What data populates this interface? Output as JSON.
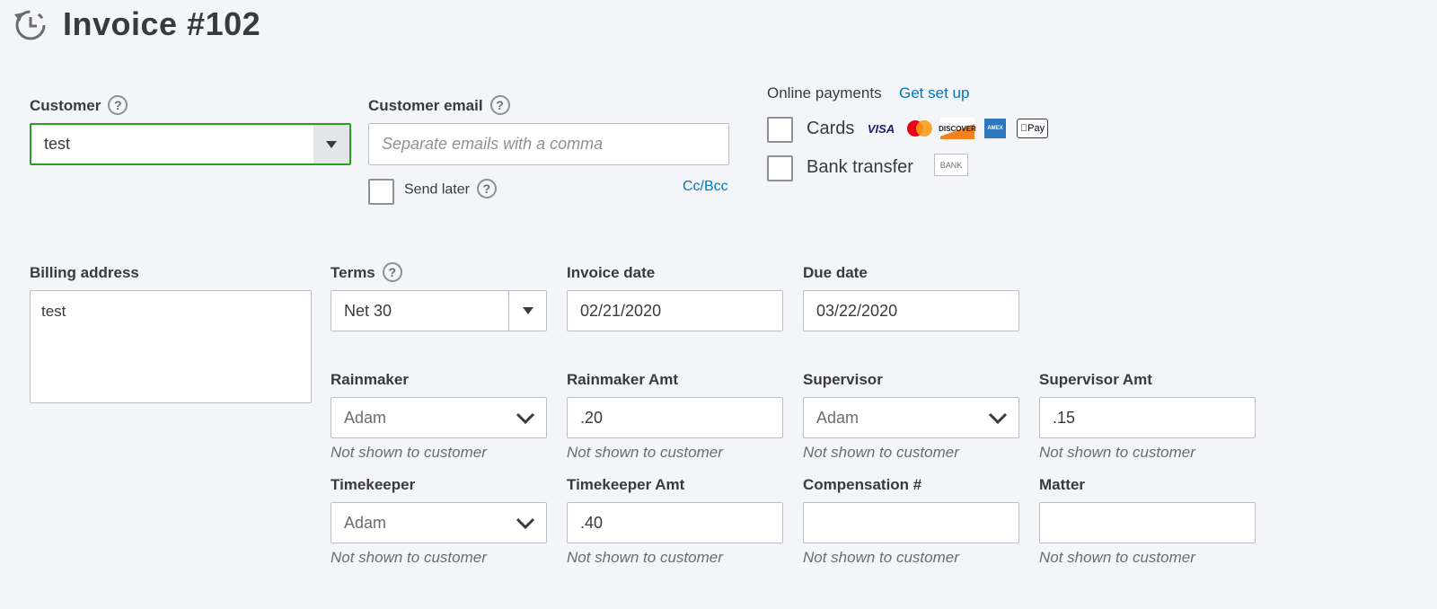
{
  "header": {
    "title": "Invoice #102",
    "icon": "recurring-clock-icon"
  },
  "customer": {
    "label": "Customer",
    "value": "test"
  },
  "customer_email": {
    "label": "Customer email",
    "placeholder": "Separate emails with a comma",
    "send_later_label": "Send later",
    "cc_bcc_label": "Cc/Bcc"
  },
  "online_payments": {
    "label": "Online payments",
    "setup_link": "Get set up",
    "cards_label": "Cards",
    "bank_transfer_label": "Bank transfer",
    "card_logos": {
      "visa": "VISA",
      "mastercard": "MasterCard",
      "discover": "DISCOVER",
      "amex": "AMEX",
      "applepay": "Pay"
    },
    "bank_badge": "BANK"
  },
  "billing_address": {
    "label": "Billing address",
    "value": "test"
  },
  "terms": {
    "label": "Terms",
    "value": "Net 30"
  },
  "invoice_date": {
    "label": "Invoice date",
    "value": "02/21/2020"
  },
  "due_date": {
    "label": "Due date",
    "value": "03/22/2020"
  },
  "custom_fields": {
    "note": "Not shown to customer",
    "rainmaker": {
      "label": "Rainmaker",
      "value": "Adam"
    },
    "rainmaker_amt": {
      "label": "Rainmaker Amt",
      "value": ".20"
    },
    "supervisor": {
      "label": "Supervisor",
      "value": "Adam"
    },
    "supervisor_amt": {
      "label": "Supervisor Amt",
      "value": ".15"
    },
    "timekeeper": {
      "label": "Timekeeper",
      "value": "Adam"
    },
    "timekeeper_amt": {
      "label": "Timekeeper Amt",
      "value": ".40"
    },
    "compensation": {
      "label": "Compensation #",
      "value": ""
    },
    "matter": {
      "label": "Matter",
      "value": ""
    }
  },
  "colors": {
    "accent_green": "#2ca01c",
    "link_blue": "#0077c5",
    "background": "#f4f5f8"
  }
}
